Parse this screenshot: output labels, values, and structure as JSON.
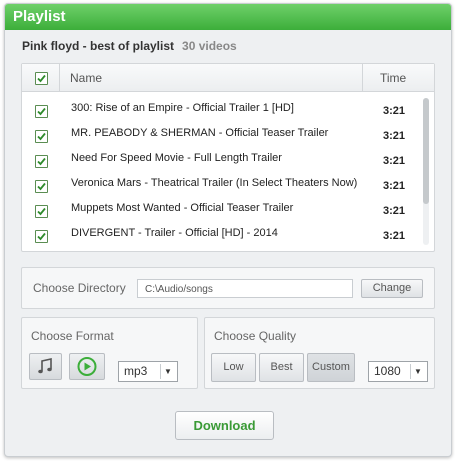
{
  "app": {
    "title": "Playlist"
  },
  "playlist": {
    "name": "Pink floyd - best of playlist",
    "count": "30 videos"
  },
  "table": {
    "columns": {
      "name": "Name",
      "time": "Time"
    },
    "rows": [
      {
        "name": "300: Rise of an Empire - Official Trailer 1 [HD]",
        "time": "3:21",
        "checked": true
      },
      {
        "name": "MR. PEABODY & SHERMAN - Official Teaser Trailer",
        "time": "3:21",
        "checked": true
      },
      {
        "name": "Need For Speed Movie - Full Length Trailer",
        "time": "3:21",
        "checked": true
      },
      {
        "name": "Veronica Mars - Theatrical Trailer  (In Select Theaters Now)",
        "time": "3:21",
        "checked": true
      },
      {
        "name": "Muppets Most Wanted - Official Teaser Trailer",
        "time": "3:21",
        "checked": true
      },
      {
        "name": "DIVERGENT - Trailer - Official [HD] - 2014",
        "time": "3:21",
        "checked": true
      }
    ]
  },
  "directory": {
    "label": "Choose Directory",
    "value": "C:\\Audio/songs",
    "button": "Change"
  },
  "format": {
    "label": "Choose Format",
    "icons": [
      "music-note-icon",
      "play-icon"
    ],
    "selected": "mp3"
  },
  "quality": {
    "label": "Choose Quality",
    "buttons": [
      "Low",
      "Best",
      "Custom"
    ],
    "active": "Custom",
    "selected": "1080"
  },
  "actions": {
    "download": "Download"
  },
  "colors": {
    "accent": "#3cae3a",
    "title_bg": "#4dbf4a"
  }
}
